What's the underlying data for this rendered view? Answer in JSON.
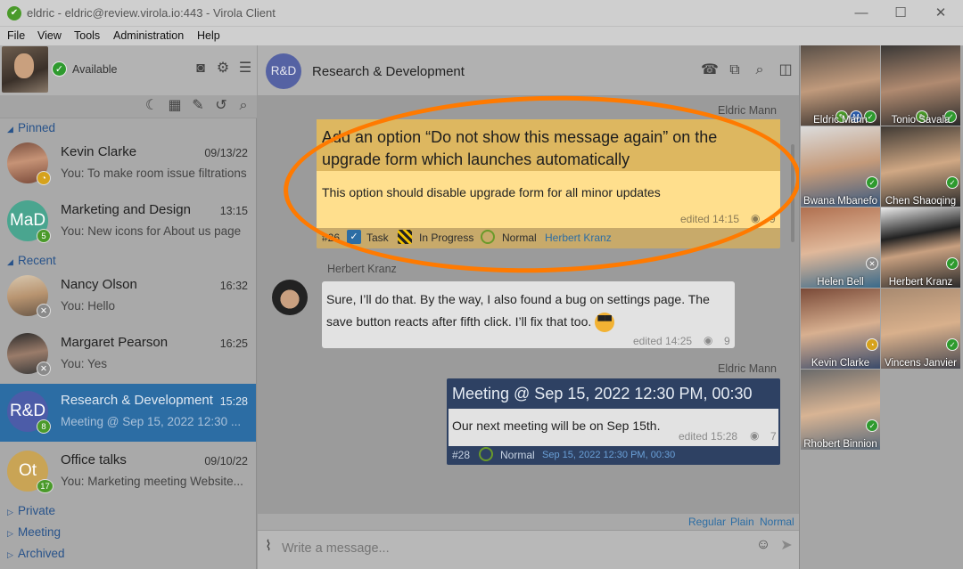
{
  "window": {
    "title": "eldric - eldric@review.virola.io:443 - Virola Client",
    "minimize": "—",
    "maximize": "☐",
    "close": "✕"
  },
  "menu": [
    "File",
    "View",
    "Tools",
    "Administration",
    "Help"
  ],
  "profile": {
    "status": "Available"
  },
  "sections": {
    "pinned": "Pinned",
    "recent": "Recent",
    "private": "Private",
    "meeting": "Meeting",
    "archived": "Archived"
  },
  "chats": [
    {
      "title": "Kevin Clarke",
      "time": "09/13/22",
      "preview": "You: To make room issue filtrations",
      "badge": "◔"
    },
    {
      "title": "Marketing and Design",
      "time": "13:15",
      "preview": "You: New icons for About us page",
      "initials": "MaD",
      "badge": "5"
    },
    {
      "title": "Nancy Olson",
      "time": "16:32",
      "preview": "You: Hello",
      "badge": "✕"
    },
    {
      "title": "Margaret Pearson",
      "time": "16:25",
      "preview": "You: Yes",
      "badge": "✕"
    },
    {
      "title": "Research & Development",
      "time": "15:28",
      "preview": "Meeting @ Sep 15, 2022 12:30 ...",
      "initials": "R&D",
      "badge": "8"
    },
    {
      "title": "Office talks",
      "time": "09/10/22",
      "preview": "You: Marketing meeting Website...",
      "initials": "Ot",
      "badge": "17"
    }
  ],
  "header": {
    "initials": "R&D",
    "title": "Research & Development"
  },
  "messages": {
    "m1": {
      "author": "Eldric Mann",
      "title": "Add an option “Do not show this message again” on the upgrade form which launches automatically",
      "body": "This option should disable upgrade form for all minor updates",
      "edited": "edited 14:15",
      "views": "9",
      "number": "#26",
      "type": "Task",
      "status": "In Progress",
      "priority": "Normal",
      "assignee": "Herbert Kranz"
    },
    "m2": {
      "author": "Herbert Kranz",
      "text": "Sure, I’ll do that. By the way, I also found a bug on settings page. The save button reacts after fifth click. I’ll fix that too.",
      "edited": "edited 14:25",
      "views": "9"
    },
    "m3": {
      "author": "Eldric Mann",
      "title": "Meeting @ Sep 15, 2022 12:30 PM, 00:30",
      "body": "Our next meeting will be on Sep 15th.",
      "edited": "edited 15:28",
      "views": "7",
      "number": "#28",
      "priority": "Normal",
      "date": "Sep 15, 2022 12:30 PM, 00:30"
    }
  },
  "format": {
    "regular": "Regular",
    "plain": "Plain",
    "normal": "Normal"
  },
  "composer": {
    "placeholder": "Write a message..."
  },
  "participants": [
    "Eldric Mann",
    "Tonio Savala",
    "Bwana Mbanefo",
    "Chen Shaoqing",
    "Helen Bell",
    "Herbert Kranz",
    "Kevin Clarke",
    "Vincens Janvier",
    "Rhobert Binnion"
  ],
  "colors": {
    "accent": "#ff7a00",
    "selection": "#2c6da4",
    "online": "#2e9a2e",
    "away": "#d6a21c"
  }
}
